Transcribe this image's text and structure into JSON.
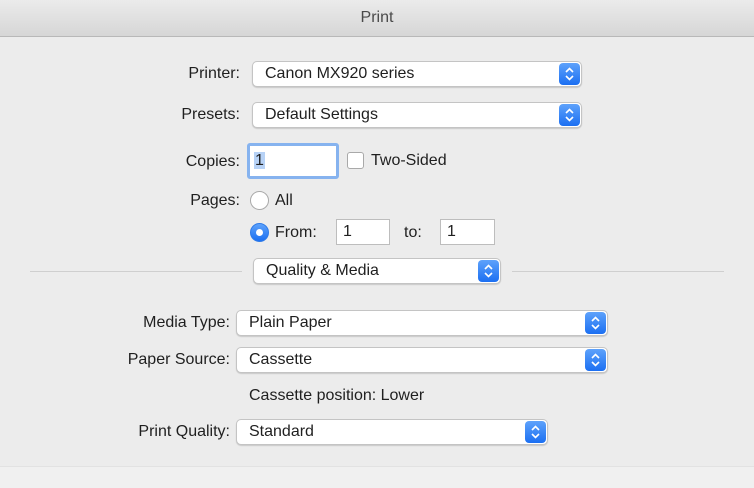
{
  "window": {
    "title": "Print"
  },
  "printer": {
    "label": "Printer:",
    "value": "Canon MX920 series"
  },
  "presets": {
    "label": "Presets:",
    "value": "Default Settings"
  },
  "copies": {
    "label": "Copies:",
    "value": "1",
    "two_sided_label": "Two-Sided",
    "two_sided_checked": false
  },
  "pages": {
    "label": "Pages:",
    "all_label": "All",
    "from_label": "From:",
    "from_value": "1",
    "to_label": "to:",
    "to_value": "1",
    "selected": "from"
  },
  "panel_select": {
    "value": "Quality & Media"
  },
  "media_type": {
    "label": "Media Type:",
    "value": "Plain Paper"
  },
  "paper_source": {
    "label": "Paper Source:",
    "value": "Cassette"
  },
  "cassette_info": "Cassette position: Lower",
  "print_quality": {
    "label": "Print Quality:",
    "value": "Standard"
  },
  "colors": {
    "accent": "#1b6ff2",
    "focus_ring": "#86b3ef"
  }
}
